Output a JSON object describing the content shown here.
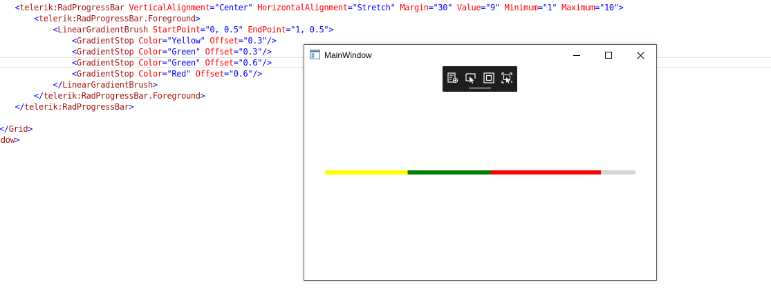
{
  "editor": {
    "lines": [
      [
        {
          "t": "    ",
          "c": "plain"
        },
        {
          "t": "<",
          "c": "tag"
        },
        {
          "t": "telerik:RadProgressBar",
          "c": "name"
        },
        {
          "t": " VerticalAlignment",
          "c": "attr"
        },
        {
          "t": "=",
          "c": "tag"
        },
        {
          "t": "\"Center\"",
          "c": "val"
        },
        {
          "t": " HorizontalAlignment",
          "c": "attr"
        },
        {
          "t": "=",
          "c": "tag"
        },
        {
          "t": "\"Stretch\"",
          "c": "val"
        },
        {
          "t": " Margin",
          "c": "attr"
        },
        {
          "t": "=",
          "c": "tag"
        },
        {
          "t": "\"30\"",
          "c": "val"
        },
        {
          "t": " Value",
          "c": "attr"
        },
        {
          "t": "=",
          "c": "tag"
        },
        {
          "t": "\"9\"",
          "c": "val"
        },
        {
          "t": " Minimum",
          "c": "attr"
        },
        {
          "t": "=",
          "c": "tag"
        },
        {
          "t": "\"1\"",
          "c": "val"
        },
        {
          "t": " Maximum",
          "c": "attr"
        },
        {
          "t": "=",
          "c": "tag"
        },
        {
          "t": "\"10\"",
          "c": "val"
        },
        {
          "t": ">",
          "c": "tag"
        }
      ],
      [
        {
          "t": "        ",
          "c": "plain"
        },
        {
          "t": "<",
          "c": "tag"
        },
        {
          "t": "telerik:RadProgressBar.Foreground",
          "c": "name"
        },
        {
          "t": ">",
          "c": "tag"
        }
      ],
      [
        {
          "t": "            ",
          "c": "plain"
        },
        {
          "t": "<",
          "c": "tag"
        },
        {
          "t": "LinearGradientBrush",
          "c": "name"
        },
        {
          "t": " StartPoint",
          "c": "attr"
        },
        {
          "t": "=",
          "c": "tag"
        },
        {
          "t": "\"0, 0.5\"",
          "c": "val"
        },
        {
          "t": " EndPoint",
          "c": "attr"
        },
        {
          "t": "=",
          "c": "tag"
        },
        {
          "t": "\"1, 0.5\"",
          "c": "val"
        },
        {
          "t": ">",
          "c": "tag"
        }
      ],
      [
        {
          "t": "                ",
          "c": "plain"
        },
        {
          "t": "<",
          "c": "tag"
        },
        {
          "t": "GradientStop",
          "c": "name"
        },
        {
          "t": " Color",
          "c": "attr"
        },
        {
          "t": "=",
          "c": "tag"
        },
        {
          "t": "\"Yellow\"",
          "c": "val"
        },
        {
          "t": " Offset",
          "c": "attr"
        },
        {
          "t": "=",
          "c": "tag"
        },
        {
          "t": "\"0.3\"",
          "c": "val"
        },
        {
          "t": "/>",
          "c": "tag"
        }
      ],
      [
        {
          "t": "                ",
          "c": "plain"
        },
        {
          "t": "<",
          "c": "tag"
        },
        {
          "t": "GradientStop",
          "c": "name"
        },
        {
          "t": " Color",
          "c": "attr"
        },
        {
          "t": "=",
          "c": "tag"
        },
        {
          "t": "\"Green\"",
          "c": "val"
        },
        {
          "t": " Offset",
          "c": "attr"
        },
        {
          "t": "=",
          "c": "tag"
        },
        {
          "t": "\"0.3\"",
          "c": "val"
        },
        {
          "t": "/>",
          "c": "tag"
        }
      ],
      [
        {
          "t": "                ",
          "c": "plain"
        },
        {
          "t": "<",
          "c": "tag"
        },
        {
          "t": "GradientStop",
          "c": "name"
        },
        {
          "t": " Color",
          "c": "attr"
        },
        {
          "t": "=",
          "c": "tag"
        },
        {
          "t": "\"Green\"",
          "c": "val"
        },
        {
          "t": " Offset",
          "c": "attr"
        },
        {
          "t": "=",
          "c": "tag"
        },
        {
          "t": "\"0.6\"",
          "c": "val"
        },
        {
          "t": "/>",
          "c": "tag"
        }
      ],
      [
        {
          "t": "                ",
          "c": "plain"
        },
        {
          "t": "<",
          "c": "tag"
        },
        {
          "t": "GradientStop",
          "c": "name"
        },
        {
          "t": " Color",
          "c": "attr"
        },
        {
          "t": "=",
          "c": "tag"
        },
        {
          "t": "\"Red\"",
          "c": "val"
        },
        {
          "t": " Offset",
          "c": "attr"
        },
        {
          "t": "=",
          "c": "tag"
        },
        {
          "t": "\"0.6\"",
          "c": "val"
        },
        {
          "t": "/>",
          "c": "tag"
        }
      ],
      [
        {
          "t": "            ",
          "c": "plain"
        },
        {
          "t": "</",
          "c": "tag"
        },
        {
          "t": "LinearGradientBrush",
          "c": "name"
        },
        {
          "t": ">",
          "c": "tag"
        }
      ],
      [
        {
          "t": "        ",
          "c": "plain"
        },
        {
          "t": "</",
          "c": "tag"
        },
        {
          "t": "telerik:RadProgressBar.Foreground",
          "c": "name"
        },
        {
          "t": ">",
          "c": "tag"
        }
      ],
      [
        {
          "t": "    ",
          "c": "plain"
        },
        {
          "t": "</",
          "c": "tag"
        },
        {
          "t": "telerik:RadProgressBar",
          "c": "name"
        },
        {
          "t": ">",
          "c": "tag"
        }
      ],
      [],
      [
        {
          "t": "</",
          "c": "tag"
        },
        {
          "t": "Grid",
          "c": "name"
        },
        {
          "t": ">",
          "c": "tag"
        }
      ],
      [
        {
          "t": "ndow",
          "c": "name"
        },
        {
          "t": ">",
          "c": "tag"
        }
      ]
    ]
  },
  "window": {
    "title": "MainWindow",
    "icon": "wpf-window-icon",
    "buttons": [
      {
        "name": "minimize",
        "icon": "minimize-icon"
      },
      {
        "name": "maximize",
        "icon": "maximize-icon"
      },
      {
        "name": "close",
        "icon": "close-icon"
      }
    ],
    "debug_toolbar": {
      "tools": [
        {
          "name": "go-to-live-visual-tree",
          "icon": "visual-tree-icon"
        },
        {
          "name": "select-element",
          "icon": "select-element-icon"
        },
        {
          "name": "display-layout-adorners",
          "icon": "layout-adorners-icon"
        },
        {
          "name": "track-focused-element",
          "icon": "track-focus-icon"
        }
      ]
    },
    "progress_bar": {
      "minimum": 1,
      "maximum": 10,
      "value": 9,
      "track_color": "#d6d6d6",
      "gradient_stops": [
        {
          "color": "#ffff00",
          "offset": 0.3
        },
        {
          "color": "#008000",
          "offset": 0.3
        },
        {
          "color": "#008000",
          "offset": 0.6
        },
        {
          "color": "#ff0000",
          "offset": 0.6
        }
      ]
    }
  }
}
